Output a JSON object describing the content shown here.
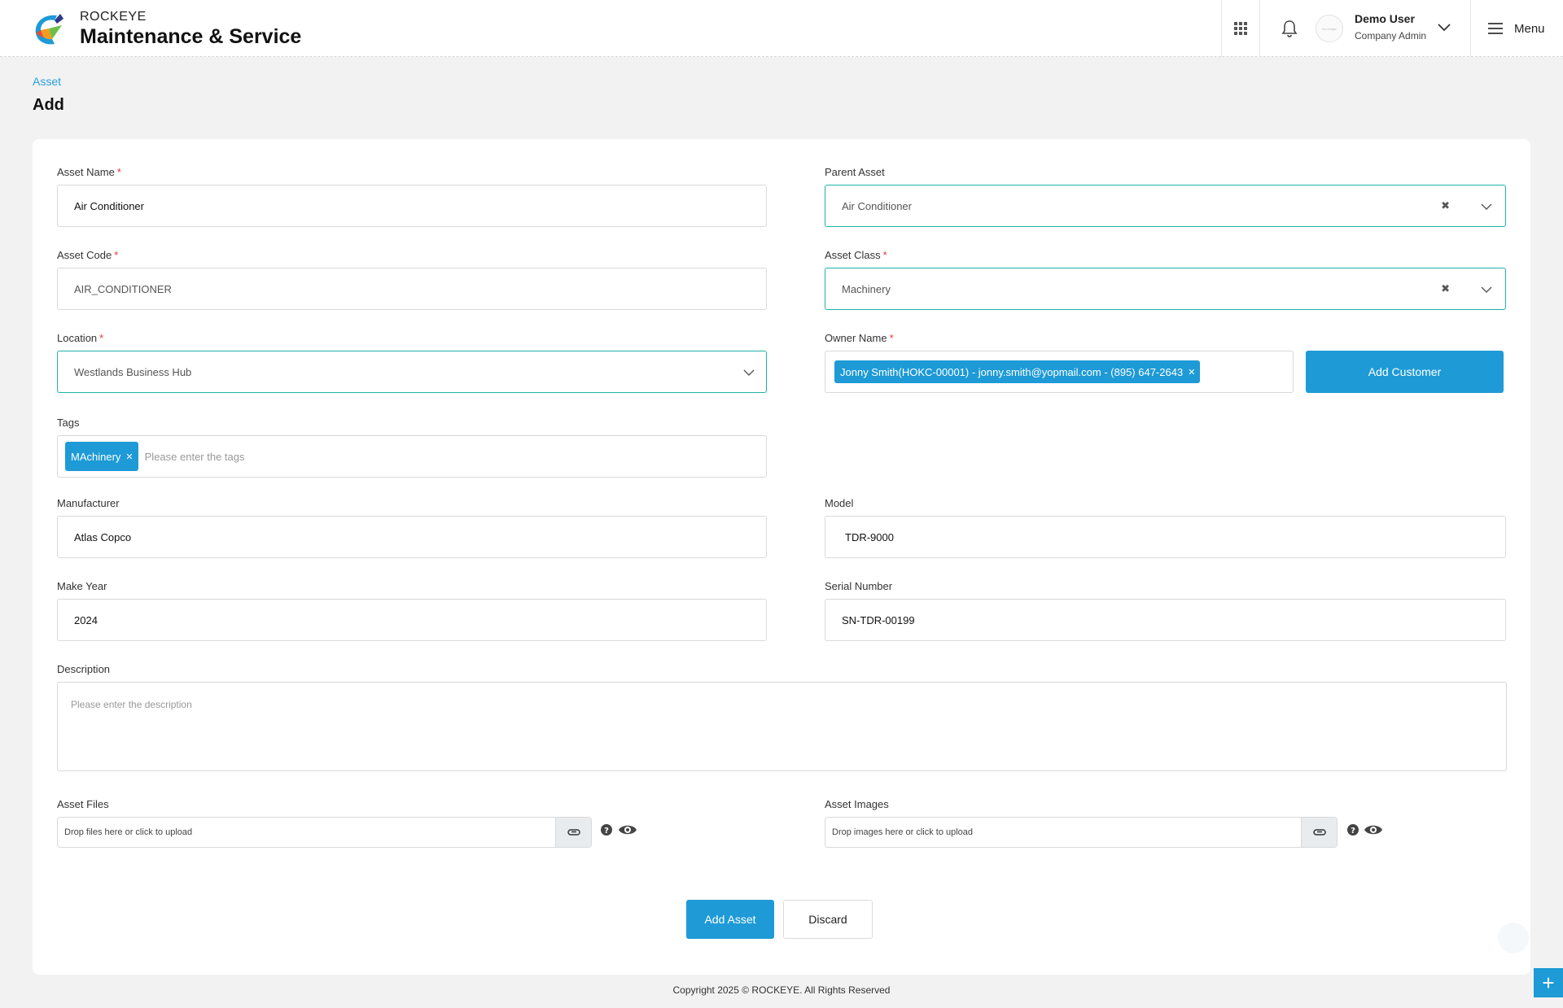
{
  "brand": {
    "top": "ROCKEYE",
    "main": "Maintenance & Service"
  },
  "header": {
    "user_name": "Demo User",
    "user_role": "Company Admin",
    "menu_label": "Menu",
    "avatar_text": "No Image",
    "icons": [
      "apps-grid-icon",
      "bell-icon",
      "chevron-down-icon",
      "hamburger-icon"
    ]
  },
  "breadcrumb": {
    "parent": "Asset"
  },
  "page": {
    "title": "Add"
  },
  "form": {
    "asset_name": {
      "label": "Asset Name",
      "value": "Air Conditioner"
    },
    "parent_asset": {
      "label": "Parent Asset",
      "value": "Air Conditioner"
    },
    "asset_code": {
      "label": "Asset Code",
      "value": "AIR_CONDITIONER"
    },
    "asset_class": {
      "label": "Asset Class",
      "value": "Machinery"
    },
    "location": {
      "label": "Location",
      "value": "Westlands Business Hub"
    },
    "owner_name": {
      "label": "Owner Name",
      "value": "Jonny Smith(HOKC-00001) - jonny.smith@yopmail.com - (895) 647-2643"
    },
    "add_customer_label": "Add Customer",
    "tags": {
      "label": "Tags",
      "chip": "MAchinery",
      "placeholder": "Please enter the tags"
    },
    "manufacturer": {
      "label": "Manufacturer",
      "value": "Atlas Copco"
    },
    "model": {
      "label": "Model",
      "value": "TDR-9000"
    },
    "make_year": {
      "label": "Make Year",
      "value": "2024"
    },
    "serial_number": {
      "label": "Serial Number",
      "value": "SN-TDR-00199"
    },
    "description": {
      "label": "Description",
      "placeholder": "Please enter the description"
    },
    "asset_files": {
      "label": "Asset Files",
      "placeholder": "Drop files here or click to upload"
    },
    "asset_images": {
      "label": "Asset Images",
      "placeholder": "Drop images here or click to upload"
    }
  },
  "actions": {
    "submit": "Add Asset",
    "discard": "Discard"
  },
  "footer": {
    "text": "Copyright 2025 © ROCKEYE. All Rights Reserved"
  },
  "colors": {
    "accent": "#1e9ad6",
    "focus_border": "#1fb2a6",
    "required": "#e53935"
  }
}
